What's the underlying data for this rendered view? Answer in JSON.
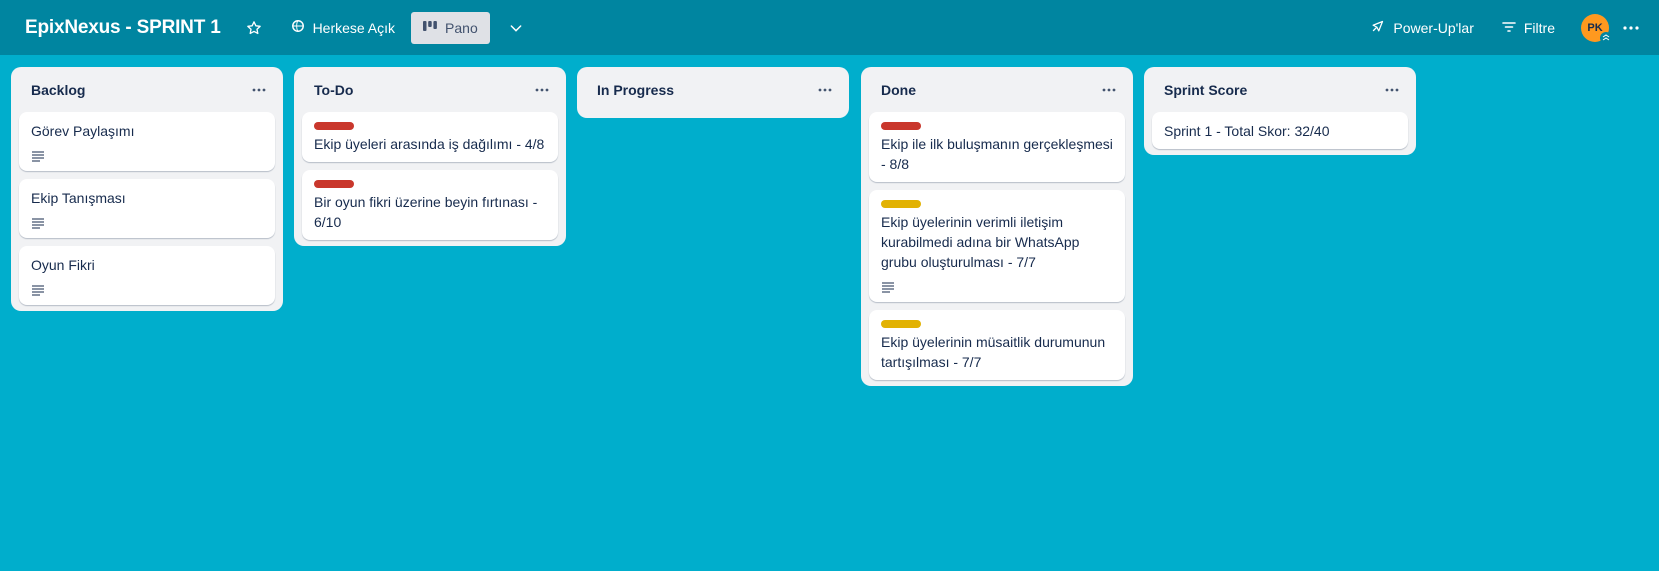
{
  "header": {
    "board_title": "EpixNexus - SPRINT 1",
    "visibility_label": "Herkese Açık",
    "view_label": "Pano",
    "powerups_label": "Power-Up'lar",
    "filter_label": "Filtre",
    "avatar_initials": "PK"
  },
  "colors": {
    "background": "#00aecc",
    "header": "#0085a0",
    "label_red": "#c9372c",
    "label_yellow": "#e2b203",
    "avatar": "#ff991f"
  },
  "lists": [
    {
      "title": "Backlog",
      "cards": [
        {
          "title": "Görev Paylaşımı",
          "label": null,
          "has_description": true
        },
        {
          "title": "Ekip Tanışması",
          "label": null,
          "has_description": true
        },
        {
          "title": "Oyun Fikri",
          "label": null,
          "has_description": true
        }
      ]
    },
    {
      "title": "To-Do",
      "cards": [
        {
          "title": "Ekip üyeleri arasında iş dağılımı - 4/8",
          "label": "red",
          "has_description": false
        },
        {
          "title": "Bir oyun fikri üzerine beyin fırtınası - 6/10",
          "label": "red",
          "has_description": false
        }
      ]
    },
    {
      "title": "In Progress",
      "cards": []
    },
    {
      "title": "Done",
      "cards": [
        {
          "title": "Ekip ile ilk buluşmanın gerçekleşmesi - 8/8",
          "label": "red",
          "has_description": false
        },
        {
          "title": "Ekip üyelerinin verimli iletişim kurabilmedi adına bir WhatsApp grubu oluşturulması - 7/7",
          "label": "yellow",
          "has_description": true
        },
        {
          "title": "Ekip üyelerinin müsaitlik durumunun tartışılması - 7/7",
          "label": "yellow",
          "has_description": false
        }
      ]
    },
    {
      "title": "Sprint Score",
      "cards": [
        {
          "title": "Sprint 1 - Total Skor: 32/40",
          "label": null,
          "has_description": false
        }
      ]
    }
  ]
}
